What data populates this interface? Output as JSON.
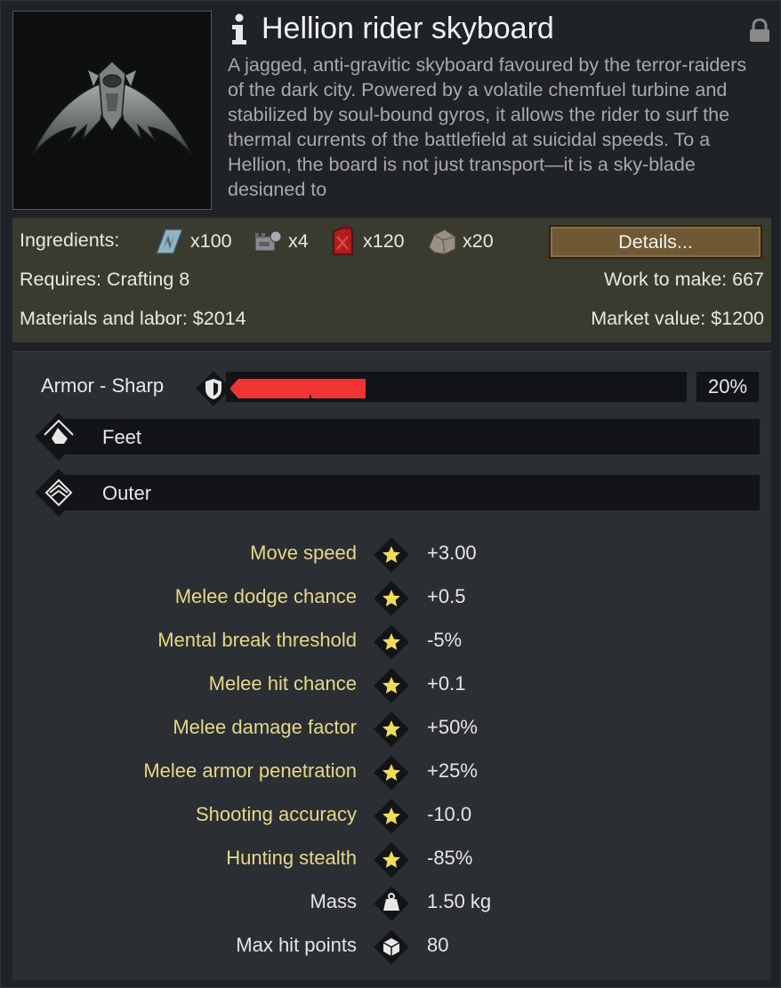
{
  "title": "Hellion rider skyboard",
  "description": "A jagged, anti-gravitic skyboard favoured by the terror-raiders of the dark city. Powered by a volatile chemfuel turbine and stabilized by soul-bound gyros, it allows the rider to surf the thermal currents of the battlefield at suicidal speeds. To a Hellion, the board is not just transport—it is a sky-blade designed to",
  "recipe": {
    "ingredients_label": "Ingredients:",
    "ingredients": [
      {
        "icon": "plasteel-icon",
        "qty": "x100"
      },
      {
        "icon": "component-icon",
        "qty": "x4"
      },
      {
        "icon": "chemfuel-icon",
        "qty": "x120"
      },
      {
        "icon": "stone-chunk-icon",
        "qty": "x20"
      }
    ],
    "details_label": "Details...",
    "requires": "Requires: Crafting 8",
    "work": "Work to make: 667",
    "materials": "Materials and labor: $2014",
    "market": "Market value: $1200"
  },
  "armor": {
    "label": "Armor - Sharp",
    "value_text": "20%",
    "fill_fraction": 0.2,
    "fill_color": "#f03434"
  },
  "layers": [
    {
      "label": "Feet",
      "icon": "feet-icon"
    },
    {
      "label": "Outer",
      "icon": "outer-layer-icon"
    }
  ],
  "stats": [
    {
      "name": "Move speed",
      "value": "+3.00",
      "icon": "star-icon",
      "highlight": true
    },
    {
      "name": "Melee dodge chance",
      "value": "+0.5",
      "icon": "star-icon",
      "highlight": true
    },
    {
      "name": "Mental break threshold",
      "value": "-5%",
      "icon": "star-icon",
      "highlight": true
    },
    {
      "name": "Melee hit chance",
      "value": "+0.1",
      "icon": "star-icon",
      "highlight": true
    },
    {
      "name": "Melee damage factor",
      "value": "+50%",
      "icon": "star-icon",
      "highlight": true
    },
    {
      "name": "Melee armor penetration",
      "value": "+25%",
      "icon": "star-icon",
      "highlight": true
    },
    {
      "name": "Shooting accuracy",
      "value": "-10.0",
      "icon": "star-icon",
      "highlight": true
    },
    {
      "name": "Hunting stealth",
      "value": "-85%",
      "icon": "star-icon",
      "highlight": true
    },
    {
      "name": "Mass",
      "value": "1.50 kg",
      "icon": "weight-icon",
      "highlight": false
    },
    {
      "name": "Max hit points",
      "value": "80",
      "icon": "cube-icon",
      "highlight": false
    }
  ],
  "colors": {
    "stat_highlight": "#e3d98a",
    "recipe_bg": "#3a3b2f",
    "details_button": "#6f5834"
  }
}
